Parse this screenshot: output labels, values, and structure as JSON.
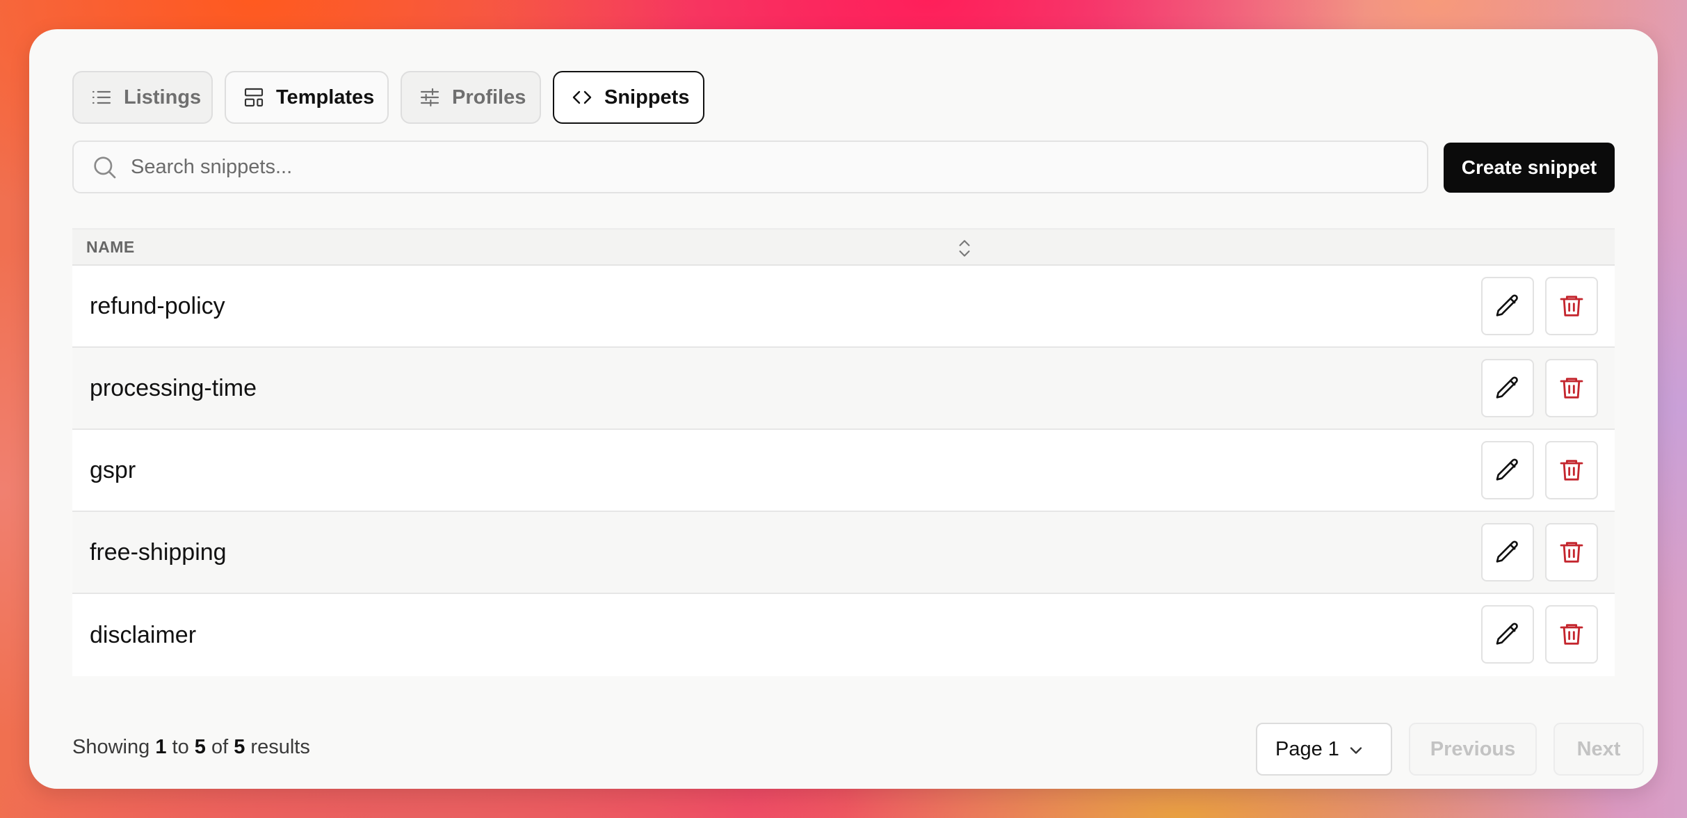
{
  "tabs": [
    {
      "label": "Listings",
      "icon": "list-icon"
    },
    {
      "label": "Templates",
      "icon": "layout-icon"
    },
    {
      "label": "Profiles",
      "icon": "sliders-icon"
    },
    {
      "label": "Snippets",
      "icon": "code-icon",
      "active": true
    }
  ],
  "search": {
    "placeholder": "Search snippets...",
    "value": ""
  },
  "create_button": "Create snippet",
  "table": {
    "column_name": "NAME",
    "rows": [
      {
        "name": "refund-policy"
      },
      {
        "name": "processing-time"
      },
      {
        "name": "gspr"
      },
      {
        "name": "free-shipping"
      },
      {
        "name": "disclaimer"
      }
    ]
  },
  "pagination": {
    "showing_prefix": "Showing",
    "from": "1",
    "to_word": "to",
    "to": "5",
    "of_word": "of",
    "total": "5",
    "results_word": "results",
    "page_label": "Page 1",
    "previous": "Previous",
    "next": "Next"
  },
  "colors": {
    "accent": "#0b0b0b",
    "delete": "#c4262e"
  }
}
